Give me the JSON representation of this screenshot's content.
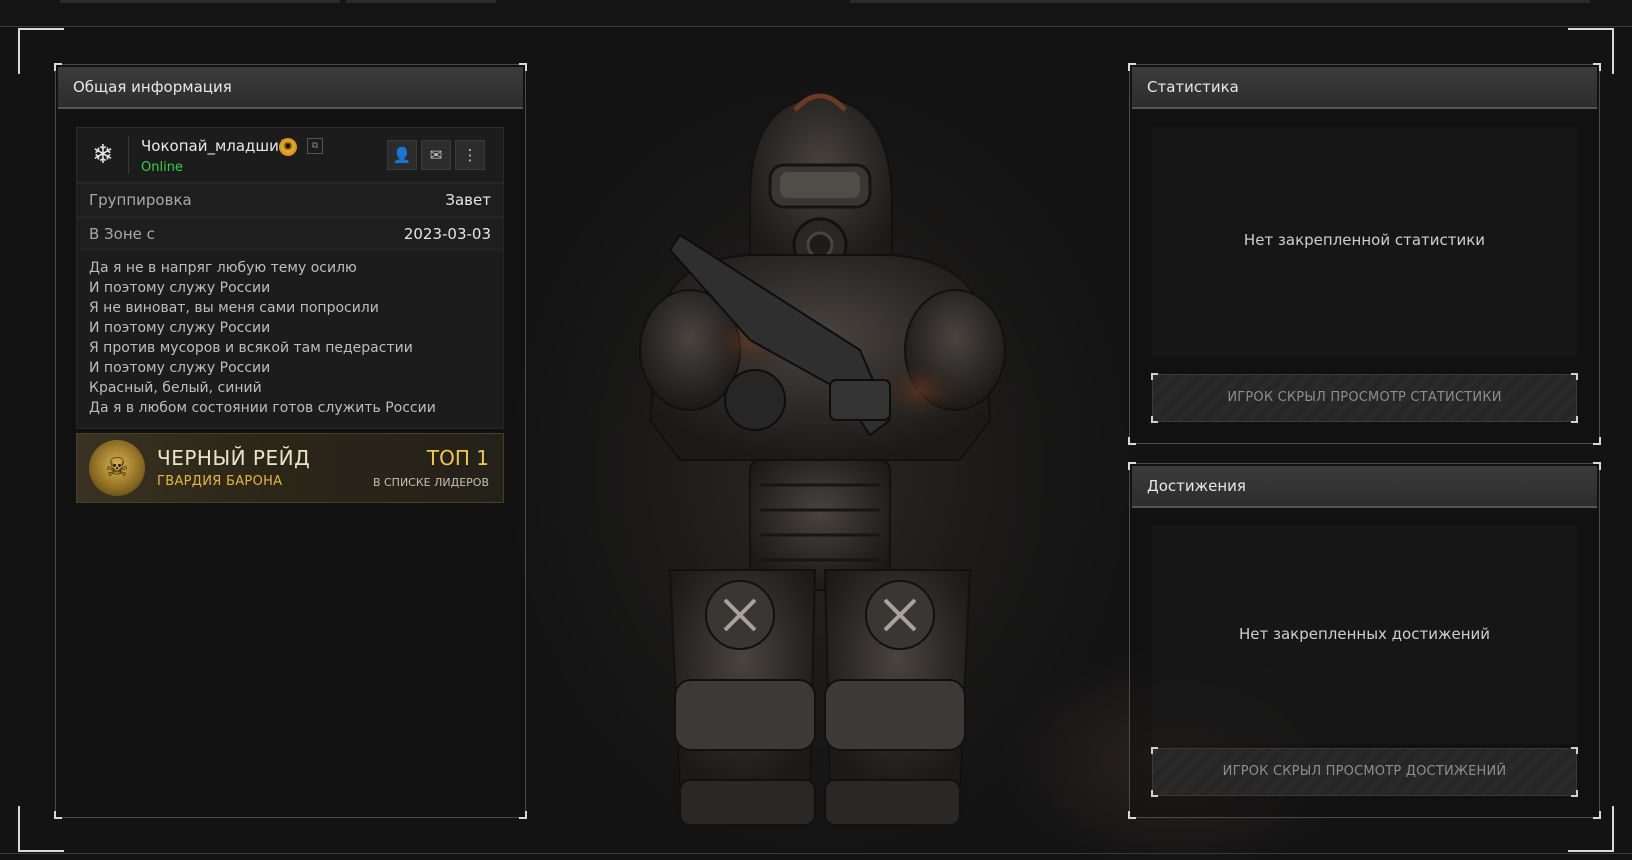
{
  "general": {
    "title": "Общая информация",
    "player": {
      "nickname": "Чокопай_младший",
      "status": "Online",
      "emblem_icon": "snowflake-icon",
      "badge_icon": "gold-rank-icon"
    },
    "rows": [
      {
        "label": "Группировка",
        "value": "Завет"
      },
      {
        "label": "В Зоне с",
        "value": "2023-03-03"
      }
    ],
    "bio": [
      "Да я не в напряг любую тему осилю",
      "И поэтому служу России",
      "Я не виноват, вы меня сами попросили",
      "И поэтому служу России",
      "Я против мусоров и всякой там педерастии",
      "И поэтому служу России",
      "Красный, белый, синий",
      "Да я в любом состоянии готов служить России"
    ],
    "raid": {
      "title": "ЧЕРНЫЙ РЕЙД",
      "subtitle": "ГВАРДИЯ БАРОНА",
      "rank": "ТОП 1",
      "rank_sub": "В СПИСКЕ ЛИДЕРОВ"
    }
  },
  "stats": {
    "title": "Статистика",
    "empty": "Нет закрепленной статистики",
    "hidden": "ИГРОК СКРЫЛ ПРОСМОТР СТАТИСТИКИ"
  },
  "achievements": {
    "title": "Достижения",
    "empty": "Нет закрепленных достижений",
    "hidden": "ИГРОК СКРЫЛ ПРОСМОТР ДОСТИЖЕНИЙ"
  },
  "colors": {
    "online": "#32d04a",
    "gold": "#f2c64a",
    "panel_header": "#343434"
  }
}
